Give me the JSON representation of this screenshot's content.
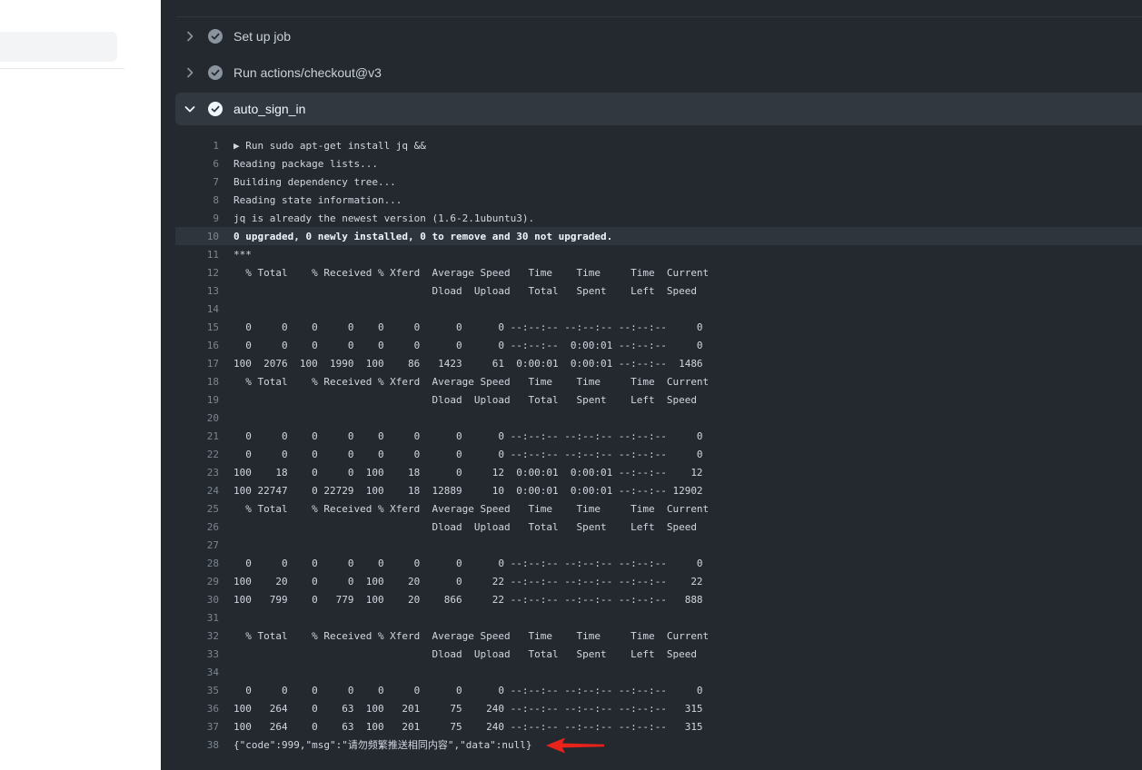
{
  "steps": [
    {
      "label": "Set up job",
      "status": "success",
      "expanded": false
    },
    {
      "label": "Run actions/checkout@v3",
      "status": "success",
      "expanded": false
    },
    {
      "label": "auto_sign_in",
      "status": "success",
      "expanded": true
    }
  ],
  "log_lines": [
    {
      "n": "1",
      "t": "▶ Run sudo apt-get install jq &&"
    },
    {
      "n": "6",
      "t": "Reading package lists..."
    },
    {
      "n": "7",
      "t": "Building dependency tree..."
    },
    {
      "n": "8",
      "t": "Reading state information..."
    },
    {
      "n": "9",
      "t": "jq is already the newest version (1.6-2.1ubuntu3)."
    },
    {
      "n": "10",
      "t": "0 upgraded, 0 newly installed, 0 to remove and 30 not upgraded.",
      "highlight": true
    },
    {
      "n": "11",
      "t": "***"
    },
    {
      "n": "12",
      "t": "  % Total    % Received % Xferd  Average Speed   Time    Time     Time  Current"
    },
    {
      "n": "13",
      "t": "                                 Dload  Upload   Total   Spent    Left  Speed"
    },
    {
      "n": "14",
      "t": ""
    },
    {
      "n": "15",
      "t": "  0     0    0     0    0     0      0      0 --:--:-- --:--:-- --:--:--     0"
    },
    {
      "n": "16",
      "t": "  0     0    0     0    0     0      0      0 --:--:--  0:00:01 --:--:--     0"
    },
    {
      "n": "17",
      "t": "100  2076  100  1990  100    86   1423     61  0:00:01  0:00:01 --:--:--  1486"
    },
    {
      "n": "18",
      "t": "  % Total    % Received % Xferd  Average Speed   Time    Time     Time  Current"
    },
    {
      "n": "19",
      "t": "                                 Dload  Upload   Total   Spent    Left  Speed"
    },
    {
      "n": "20",
      "t": ""
    },
    {
      "n": "21",
      "t": "  0     0    0     0    0     0      0      0 --:--:-- --:--:-- --:--:--     0"
    },
    {
      "n": "22",
      "t": "  0     0    0     0    0     0      0      0 --:--:-- --:--:-- --:--:--     0"
    },
    {
      "n": "23",
      "t": "100    18    0     0  100    18      0     12  0:00:01  0:00:01 --:--:--    12"
    },
    {
      "n": "24",
      "t": "100 22747    0 22729  100    18  12889     10  0:00:01  0:00:01 --:--:-- 12902"
    },
    {
      "n": "25",
      "t": "  % Total    % Received % Xferd  Average Speed   Time    Time     Time  Current"
    },
    {
      "n": "26",
      "t": "                                 Dload  Upload   Total   Spent    Left  Speed"
    },
    {
      "n": "27",
      "t": ""
    },
    {
      "n": "28",
      "t": "  0     0    0     0    0     0      0      0 --:--:-- --:--:-- --:--:--     0"
    },
    {
      "n": "29",
      "t": "100    20    0     0  100    20      0     22 --:--:-- --:--:-- --:--:--    22"
    },
    {
      "n": "30",
      "t": "100   799    0   779  100    20    866     22 --:--:-- --:--:-- --:--:--   888"
    },
    {
      "n": "31",
      "t": ""
    },
    {
      "n": "32",
      "t": "  % Total    % Received % Xferd  Average Speed   Time    Time     Time  Current"
    },
    {
      "n": "33",
      "t": "                                 Dload  Upload   Total   Spent    Left  Speed"
    },
    {
      "n": "34",
      "t": ""
    },
    {
      "n": "35",
      "t": "  0     0    0     0    0     0      0      0 --:--:-- --:--:-- --:--:--     0"
    },
    {
      "n": "36",
      "t": "100   264    0    63  100   201     75    240 --:--:-- --:--:-- --:--:--   315"
    },
    {
      "n": "37",
      "t": "100   264    0    63  100   201     75    240 --:--:-- --:--:-- --:--:--   315"
    },
    {
      "n": "38",
      "t": "{\"code\":999,\"msg\":\"请勿频繁推送相同内容\",\"data\":null}"
    }
  ],
  "colors": {
    "panel_bg": "#24292f",
    "success_icon": "#8b949e",
    "annotation_arrow": "#e8231b"
  },
  "icons": {
    "collapsed": "chevron-right-icon",
    "expanded": "chevron-down-icon",
    "status": "check-circle-icon",
    "annotation": "red-arrow-icon"
  }
}
